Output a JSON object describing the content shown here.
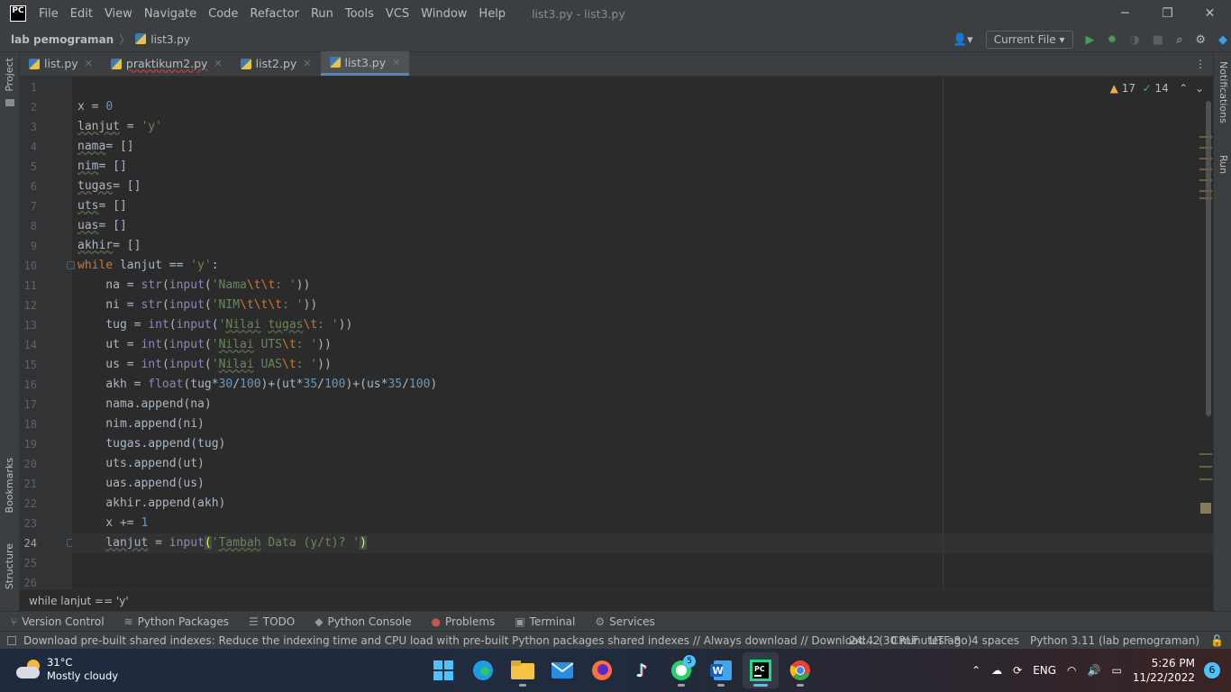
{
  "app": {
    "logo": "PC",
    "window_title": "list3.py - list3.py"
  },
  "menu": [
    "File",
    "Edit",
    "View",
    "Navigate",
    "Code",
    "Refactor",
    "Run",
    "Tools",
    "VCS",
    "Window",
    "Help"
  ],
  "window_controls": {
    "minimize": "─",
    "restore": "❐",
    "close": "✕"
  },
  "breadcrumb": {
    "project": "lab pemograman",
    "file": "list3.py"
  },
  "run_config": {
    "label": "Current File"
  },
  "side_labels": {
    "project": "Project",
    "bookmarks": "Bookmarks",
    "structure": "Structure",
    "notifications": "Notifications",
    "run": "Run"
  },
  "tabs": [
    {
      "label": "list.py"
    },
    {
      "label": "praktikum2.py"
    },
    {
      "label": "list2.py"
    },
    {
      "label": "list3.py",
      "active": true
    }
  ],
  "inspections": {
    "warnings": "17",
    "weak_warnings": "14"
  },
  "editor": {
    "current_line": 24,
    "line_numbers": [
      "1",
      "2",
      "3",
      "4",
      "5",
      "6",
      "7",
      "8",
      "9",
      "10",
      "11",
      "12",
      "13",
      "14",
      "15",
      "16",
      "17",
      "18",
      "19",
      "20",
      "21",
      "22",
      "23",
      "24",
      "25",
      "26"
    ]
  },
  "code_lines": [
    "",
    "x = 0",
    "lanjut = 'y'",
    "nama= []",
    "nim= []",
    "tugas= []",
    "uts= []",
    "uas= []",
    "akhir= []",
    "while lanjut == 'y':",
    "    na = str(input('Nama\\t\\t: '))",
    "    ni = str(input('NIM\\t\\t\\t: '))",
    "    tug = int(input('Nilai tugas\\t: '))",
    "    ut = int(input('Nilai UTS\\t: '))",
    "    us = int(input('Nilai UAS\\t: '))",
    "    akh = float(tug*30/100)+(ut*35/100)+(us*35/100)",
    "    nama.append(na)",
    "    nim.append(ni)",
    "    tugas.append(tug)",
    "    uts.append(ut)",
    "    uas.append(us)",
    "    akhir.append(akh)",
    "    x += 1",
    "    lanjut = input('Tambah Data (y/t)? ')",
    "",
    ""
  ],
  "status_context": "while lanjut == 'y'",
  "tool_windows": [
    {
      "icon": "⑂",
      "label": "Version Control"
    },
    {
      "icon": "≋",
      "label": "Python Packages"
    },
    {
      "icon": "☰",
      "label": "TODO"
    },
    {
      "icon": "◆",
      "label": "Python Console"
    },
    {
      "icon": "●",
      "label": "Problems"
    },
    {
      "icon": "▣",
      "label": "Terminal"
    },
    {
      "icon": "⚙",
      "label": "Services"
    }
  ],
  "statusbar": {
    "message": "Download pre-built shared indexes: Reduce the indexing time and CPU load with pre-built Python packages shared indexes // Always download // Download... (30 minutes ago)",
    "position": "24:42",
    "line_ending": "CRLF",
    "encoding": "UTF-8",
    "indent": "4 spaces",
    "interpreter": "Python 3.11 (lab pemograman)"
  },
  "taskbar": {
    "temperature": "31°C",
    "weather": "Mostly cloudy",
    "whatsapp_badge": "5",
    "language": "ENG",
    "time": "5:26 PM",
    "date": "11/22/2022",
    "notifications": "6"
  },
  "colors": {
    "keyword": "#cc7832",
    "string": "#6a8759",
    "number": "#6897bb",
    "builtin": "#8888c6",
    "text": "#a9b7c6",
    "accent": "#4a88c7"
  }
}
